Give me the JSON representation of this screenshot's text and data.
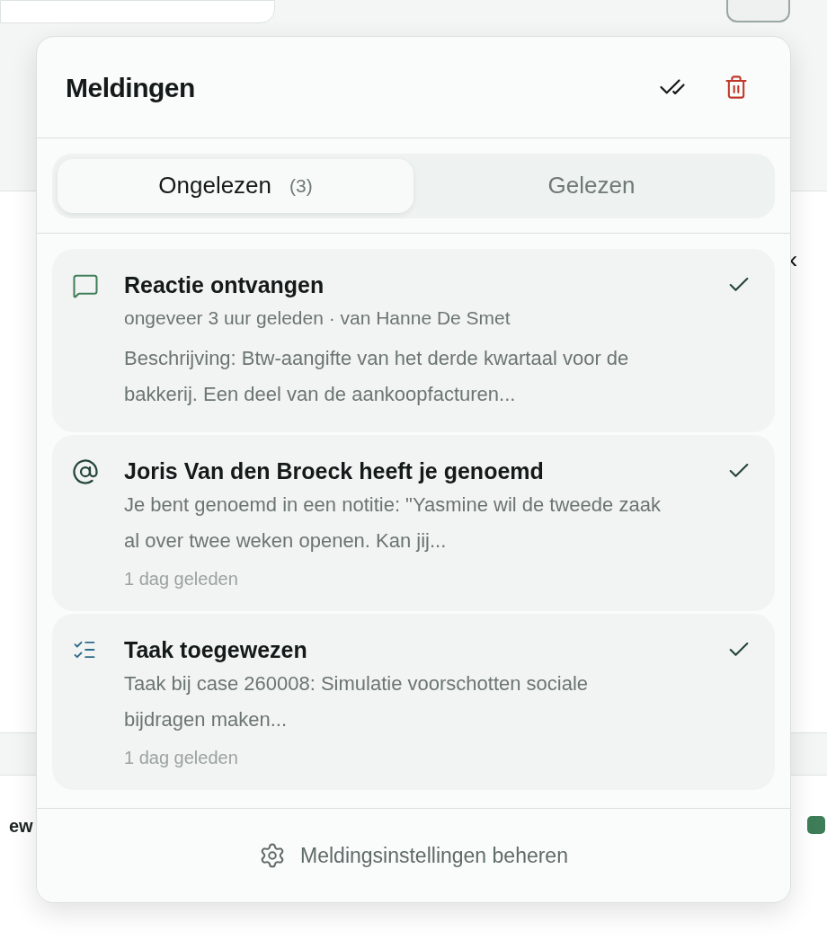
{
  "background": {
    "side_label": "ew",
    "chevron": "‹"
  },
  "panel": {
    "title": "Meldingen",
    "tabs": [
      {
        "label": "Ongelezen",
        "count": "(3)",
        "selected": true
      },
      {
        "label": "Gelezen",
        "selected": false
      }
    ],
    "notifications": [
      {
        "kind": "comment",
        "title": "Reactie ontvangen",
        "meta": "ongeveer 3 uur geleden · van Hanne De Smet",
        "description": "Beschrijving: Btw-aangifte van het derde kwartaal voor de bakkerij. Een deel van de aankoopfacturen..."
      },
      {
        "kind": "mention",
        "title": "Joris Van den Broeck heeft je genoemd",
        "description": "Je bent genoemd in een notitie: \"Yasmine wil de tweede zaak al over twee weken openen. Kan jij...",
        "time": "1 dag geleden"
      },
      {
        "kind": "task",
        "title": "Taak toegewezen",
        "description": "Taak bij case 260008: Simulatie voorschotten sociale bijdragen maken...",
        "time": "1 dag geleden"
      }
    ],
    "footer": "Meldingsinstellingen beheren"
  }
}
